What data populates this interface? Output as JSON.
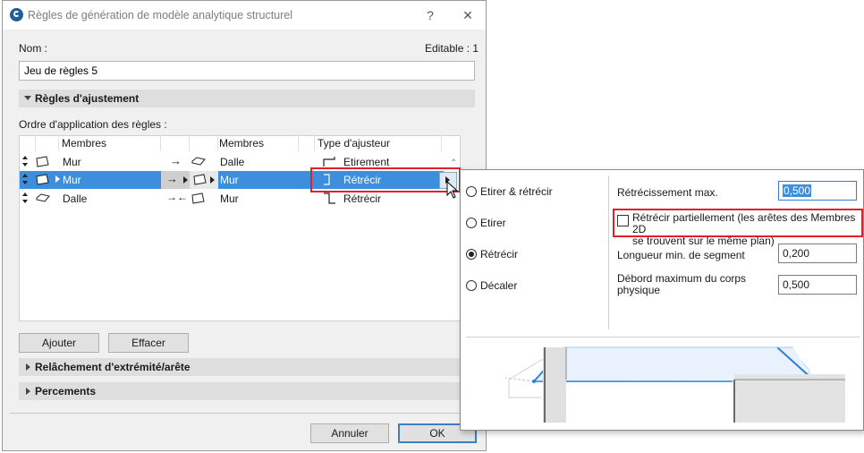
{
  "window": {
    "title": "Règles de génération de modèle analytique structurel",
    "help_label": "?",
    "close_label": "✕"
  },
  "name_field": {
    "label": "Nom :",
    "editable_text": "Editable : 1",
    "value": "Jeu de règles 5"
  },
  "sections": {
    "adjustment_rules": "Règles d'ajustement",
    "order_label": "Ordre d'application des règles :",
    "relaxation": "Relâchement d'extrémité/arête",
    "openings": "Percements"
  },
  "table": {
    "headers": [
      "Membres",
      "Membres",
      "Type d'ajusteur"
    ],
    "rows": [
      {
        "member1": "Mur",
        "member2": "Dalle",
        "type": "Etirement",
        "selected": false
      },
      {
        "member1": "Mur",
        "member2": "Mur",
        "type": "Rétrécir",
        "selected": true
      },
      {
        "member1": "Dalle",
        "member2": "Mur",
        "type": "Rétrécir",
        "selected": false
      }
    ]
  },
  "buttons": {
    "add": "Ajouter",
    "delete": "Effacer",
    "cancel": "Annuler",
    "ok": "OK"
  },
  "popup": {
    "options": [
      {
        "label": "Etirer & rétrécir",
        "checked": false
      },
      {
        "label": "Etirer",
        "checked": false
      },
      {
        "label": "Rétrécir",
        "checked": true
      },
      {
        "label": "Décaler",
        "checked": false
      }
    ],
    "max_shrink_label": "Rétrécissement max.",
    "max_shrink_value": "0,500",
    "partial_shrink_label_1": "Rétrécir partiellement (les arêtes des Membres 2D",
    "partial_shrink_label_2": "se trouvent sur le même plan)",
    "partial_shrink_checked": false,
    "min_segment_label": "Longueur min. de segment",
    "min_segment_value": "0,200",
    "max_overhang_label_1": "Débord maximum du corps",
    "max_overhang_label_2": "physique",
    "max_overhang_value": "0,500"
  },
  "colors": {
    "selection": "#3d8fdd",
    "highlight": "#e0202a",
    "preview_blue": "#2f7fd8"
  }
}
